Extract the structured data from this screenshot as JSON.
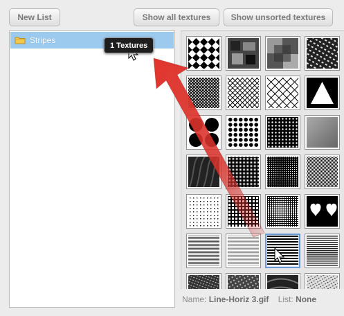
{
  "toolbar": {
    "new_list": "New List",
    "show_all": "Show all textures",
    "show_unsorted": "Show unsorted textures"
  },
  "lists": [
    {
      "label": "Stripes",
      "icon": "folder-icon",
      "selected": true
    }
  ],
  "drag_tooltip": "1 Textures",
  "status": {
    "name_label": "Name:",
    "name_value": "Line-Horiz 3.gif",
    "list_label": "List:",
    "list_value": "None"
  },
  "colors": {
    "selection": "#9cc9ee",
    "arrow": "#d9322b",
    "tile_selected_border": "#6a98d8"
  }
}
